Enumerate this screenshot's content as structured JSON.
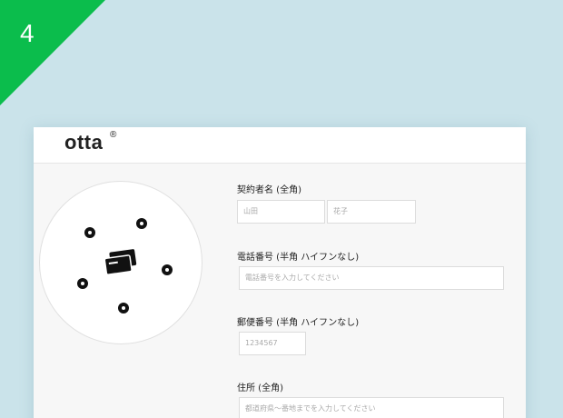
{
  "step": {
    "number": "4"
  },
  "brand": {
    "name": "otta",
    "mark": "®"
  },
  "colors": {
    "background": "#cae3ea",
    "accent": "#0bbd4c",
    "card": "#f7f7f7"
  },
  "device": {
    "icon": "otta-device-with-cards-icon"
  },
  "form": {
    "name": {
      "label": "契約者名 (全角)",
      "last_placeholder": "山田",
      "first_placeholder": "花子"
    },
    "phone": {
      "label": "電話番号 (半角 ハイフンなし)",
      "placeholder": "電話番号を入力してください"
    },
    "postal": {
      "label": "郵便番号 (半角 ハイフンなし)",
      "placeholder": "1234567"
    },
    "address": {
      "label": "住所 (全角)",
      "placeholder": "都道府県〜番地までを入力してください"
    }
  }
}
